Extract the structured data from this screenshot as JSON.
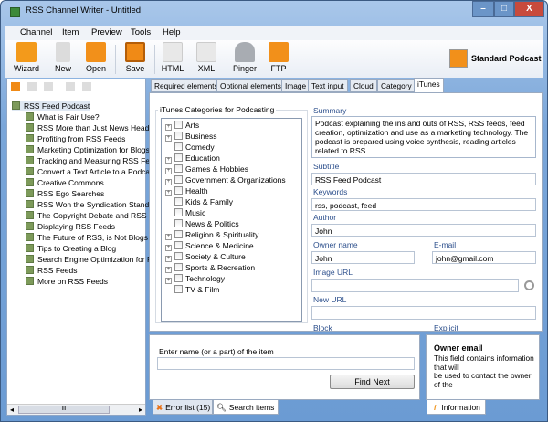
{
  "window": {
    "title": "RSS Channel Writer - Untitled",
    "minimize": "–",
    "maximize": "□",
    "close": "X"
  },
  "menu": [
    "Channel",
    "Item",
    "Preview",
    "Tools",
    "Help"
  ],
  "toolbar": [
    {
      "label": "Wizard",
      "icon": "wizard-icon"
    },
    {
      "label": "New",
      "icon": "new-file-icon"
    },
    {
      "label": "Open",
      "icon": "folder-icon"
    },
    {
      "label": "Save",
      "icon": "save-icon"
    },
    {
      "label": "HTML",
      "icon": "html-icon"
    },
    {
      "label": "XML",
      "icon": "xml-icon"
    },
    {
      "label": "Pinger",
      "icon": "bell-icon"
    },
    {
      "label": "FTP",
      "icon": "ftp-icon"
    }
  ],
  "podcast_badge": "Standard Podcast",
  "tree": {
    "root": "RSS Feed Podcast",
    "items": [
      "What is Fair Use?",
      "RSS More than Just News Headli",
      "Profiting from RSS Feeds",
      "Marketing Optimization for Blogs",
      "Tracking and Measuring RSS Fee",
      "Convert a Text Article to a Podca",
      "Creative Commons",
      "RSS Ego Searches",
      "RSS Won the Syndication Stand",
      "The Copyright Debate and RSS",
      "Displaying RSS Feeds",
      "The Future of RSS, is Not Blogs",
      "Tips to Creating a Blog",
      "Search Engine Optimization for R",
      "RSS Feeds",
      "More on RSS Feeds"
    ],
    "scroll_thumb": "III"
  },
  "tabs": [
    "Required elements",
    "Optional elements",
    "Image",
    "Text input",
    "Cloud",
    "Category",
    "iTunes"
  ],
  "categories": {
    "title": "iTunes Categories for Podcasting",
    "items": [
      {
        "name": "Arts",
        "expand": "+"
      },
      {
        "name": "Business",
        "expand": "+"
      },
      {
        "name": "Comedy"
      },
      {
        "name": "Education",
        "expand": "+"
      },
      {
        "name": "Games & Hobbies",
        "expand": "+"
      },
      {
        "name": "Government & Organizations",
        "expand": "+"
      },
      {
        "name": "Health",
        "expand": "+"
      },
      {
        "name": "Kids & Family"
      },
      {
        "name": "Music"
      },
      {
        "name": "News & Politics"
      },
      {
        "name": "Religion & Spirituality",
        "expand": "+"
      },
      {
        "name": "Science & Medicine",
        "expand": "+"
      },
      {
        "name": "Society & Culture",
        "expand": "+"
      },
      {
        "name": "Sports & Recreation",
        "expand": "+"
      },
      {
        "name": "Technology",
        "expand": "+"
      },
      {
        "name": "TV & Film"
      }
    ]
  },
  "form": {
    "summary_label": "Summary",
    "summary": "Podcast explaining the ins and outs of RSS, RSS feeds, feed creation, optimization and use as a marketing technology. The podcast is prepared using voice synthesis, reading articles related to RSS.",
    "subtitle_label": "Subtitle",
    "subtitle": "RSS Feed Podcast",
    "keywords_label": "Keywords",
    "keywords": "rss, podcast, feed",
    "author_label": "Author",
    "author": "John",
    "owner_label": "Owner name",
    "owner": "John",
    "email_label": "E-mail",
    "email": "john@gmail.com",
    "image_label": "Image URL",
    "image": "",
    "newurl_label": "New URL",
    "newurl": "",
    "block_label": "Block",
    "explicit_label": "Explicit"
  },
  "search": {
    "label": "Enter name (or a part) of the item",
    "value": "",
    "button": "Find Next"
  },
  "info": {
    "title": "Owner email",
    "text": "This field contains information that will\nbe used to contact the owner of the"
  },
  "bottom_tabs": {
    "errors": "Error list (15)",
    "search": "Search items",
    "info": "Information"
  }
}
